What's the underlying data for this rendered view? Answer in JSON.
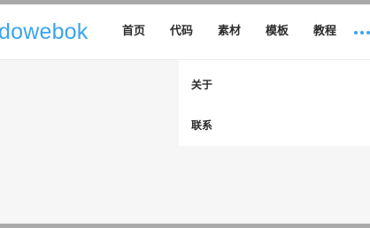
{
  "header": {
    "logo_text": "dowebok",
    "nav": [
      {
        "label": "首页"
      },
      {
        "label": "代码"
      },
      {
        "label": "素材"
      },
      {
        "label": "模板"
      },
      {
        "label": "教程"
      }
    ],
    "more_icon": "more-dots-icon"
  },
  "dropdown": {
    "items": [
      {
        "label": "关于"
      },
      {
        "label": "联系"
      }
    ]
  },
  "colors": {
    "accent": "#3aa4f0",
    "text": "#2b2b2b",
    "page_background": "#f6f6f6",
    "frame": "#a9a9a9"
  }
}
